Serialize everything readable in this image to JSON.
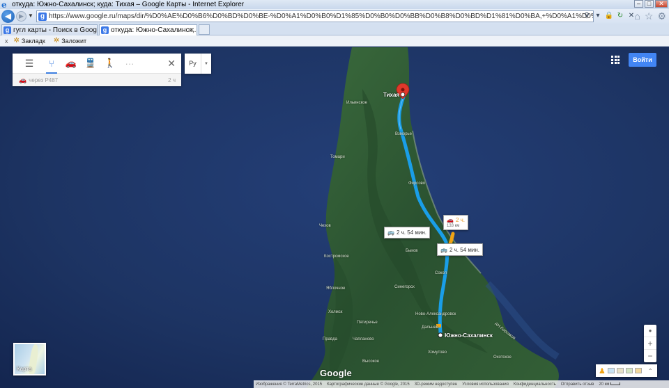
{
  "window": {
    "title": "откуда: Южно-Сахалинск; куда: Тихая – Google Карты - Internet Explorer",
    "minimize": "–",
    "maximize": "□",
    "close": "✕"
  },
  "address": {
    "url": "https://www.google.ru/maps/dir/%D0%AE%D0%B6%D0%BD%D0%BE-%D0%A1%D0%B0%D1%85%D0%B0%D0%BB%D0%B8%D0%BD%D1%81%D0%BA,+%D0%A1%D0%B0%D1%85%D0%B0%D0%BB"
  },
  "tabs": [
    {
      "label": "гугл карты - Поиск в Google",
      "favicon": "g"
    },
    {
      "label": "откуда: Южно-Сахалинск;...",
      "favicon": "g",
      "close": "✕"
    }
  ],
  "favorites": {
    "close": "x",
    "items": [
      {
        "label": "Закладк",
        "icon": "star-add-icon"
      },
      {
        "label": "Заложит",
        "icon": "star-icon"
      }
    ]
  },
  "directions": {
    "modes": [
      "menu-icon",
      "best-route-icon",
      "car-icon",
      "transit-icon",
      "walk-icon",
      "more-icon"
    ],
    "more": "···",
    "close": "✕",
    "route": {
      "via": "через Р487",
      "duration": "2 ч"
    }
  },
  "language": {
    "code": "Ру",
    "arrow": "▼"
  },
  "signin": "Войти",
  "map_labels": {
    "tikhaya": "Тихая",
    "ilyinskoe": "Ильинское",
    "vzmorye": "Взморье",
    "tomari": "Томари",
    "firsovo": "Фирсово",
    "chekhov": "Чехов",
    "bykov": "Быков",
    "kostromskoe": "Костромское",
    "sokol": "Сокол",
    "sinegorsk": "Синегорск",
    "yablochnoe": "Яблочное",
    "novo_alexandrovsk": "Ново-Александровск",
    "kholmsk": "Холмск",
    "pyatirechye": "Пятиречье",
    "dalnee": "Дальнее",
    "yuzhno_sakhalinsk": "Южно-Сахалинск",
    "pravda": "Правда",
    "chaplanovo": "Чапланово",
    "khomutovo": "Хомутово",
    "vysokoe": "Высокое",
    "okhotskoe": "Охотское",
    "korsakov_road": "АН-Корсаков"
  },
  "route_labels": {
    "car": {
      "time": "2 ч.",
      "dist": "133 км"
    },
    "transit1": "2 ч. 54 мин.",
    "transit2": "2 ч. 54 мин."
  },
  "map_type": {
    "label": "Карта"
  },
  "logo": "Google",
  "zoom": {
    "compass": "●",
    "in": "+",
    "out": "−",
    "expand": "⌃"
  },
  "footer": {
    "imagery": "Изображения © TerraMetrics, 2015",
    "mapdata": "Картографические данные © Google, 2015",
    "mode3d": "3D-режим недоступен",
    "terms": "Условия использования",
    "privacy": "Конфиденциальность",
    "feedback": "Отправить отзыв",
    "scale": "20 км"
  },
  "colors": {
    "route_primary": "#1a9ee8",
    "route_alt": "#f0a314",
    "water": "#1d3463",
    "land": "#2f5a34",
    "accent": "#4285f4"
  }
}
